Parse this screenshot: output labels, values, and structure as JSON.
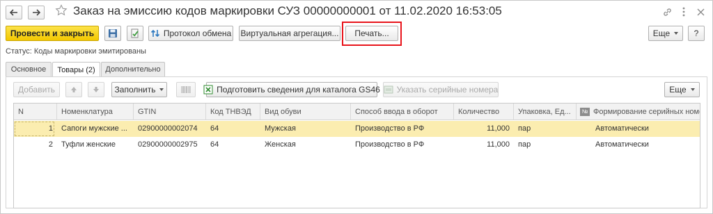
{
  "window": {
    "title": "Заказ на эмиссию кодов маркировки СУЗ 00000000001 от 11.02.2020 16:53:05",
    "icons": [
      "back-arrow-icon",
      "forward-arrow-icon",
      "star-icon",
      "link-icon",
      "more-dots-icon",
      "close-icon"
    ]
  },
  "toolbar": {
    "post_and_close": "Провести и закрыть",
    "exchange_protocol": "Протокол обмена",
    "virtual_aggregation": "Виртуальная агрегация...",
    "print": "Печать...",
    "more": "Еще",
    "help": "?"
  },
  "status": "Статус: Коды маркировки эмитированы",
  "tabs": [
    {
      "label": "Основное",
      "active": false
    },
    {
      "label": "Товары (2)",
      "active": true
    },
    {
      "label": "Дополнительно",
      "active": false
    }
  ],
  "goods_toolbar": {
    "add": "Добавить",
    "fill": "Заполнить",
    "prepare_gs46": "Подготовить сведения для каталога GS46",
    "serial_numbers": "Указать серийные номера",
    "more": "Еще"
  },
  "table": {
    "columns": [
      "N",
      "Номенклатура",
      "GTIN",
      "Код ТНВЭД",
      "Вид обуви",
      "Способ ввода в оборот",
      "Количество",
      "Упаковка, Ед...",
      "Формирование серийных номе"
    ],
    "column_icon_label": "№",
    "rows": [
      {
        "n": "1",
        "item": "Сапоги мужские ...",
        "gtin": "02900000002074",
        "tnved": "64",
        "shoe_type": "Мужская",
        "entry_method": "Производство в РФ",
        "qty": "11,000",
        "pack": "пар",
        "serial": "Автоматически",
        "selected": true
      },
      {
        "n": "2",
        "item": "Туфли женские",
        "gtin": "02900000002975",
        "tnved": "64",
        "shoe_type": "Женская",
        "entry_method": "Производство в РФ",
        "qty": "11,000",
        "pack": "пар",
        "serial": "Автоматически",
        "selected": false
      }
    ]
  },
  "colors": {
    "primary_button": "#f3c800",
    "highlight_frame": "#e8141b",
    "selected_row": "#fbedb0"
  }
}
